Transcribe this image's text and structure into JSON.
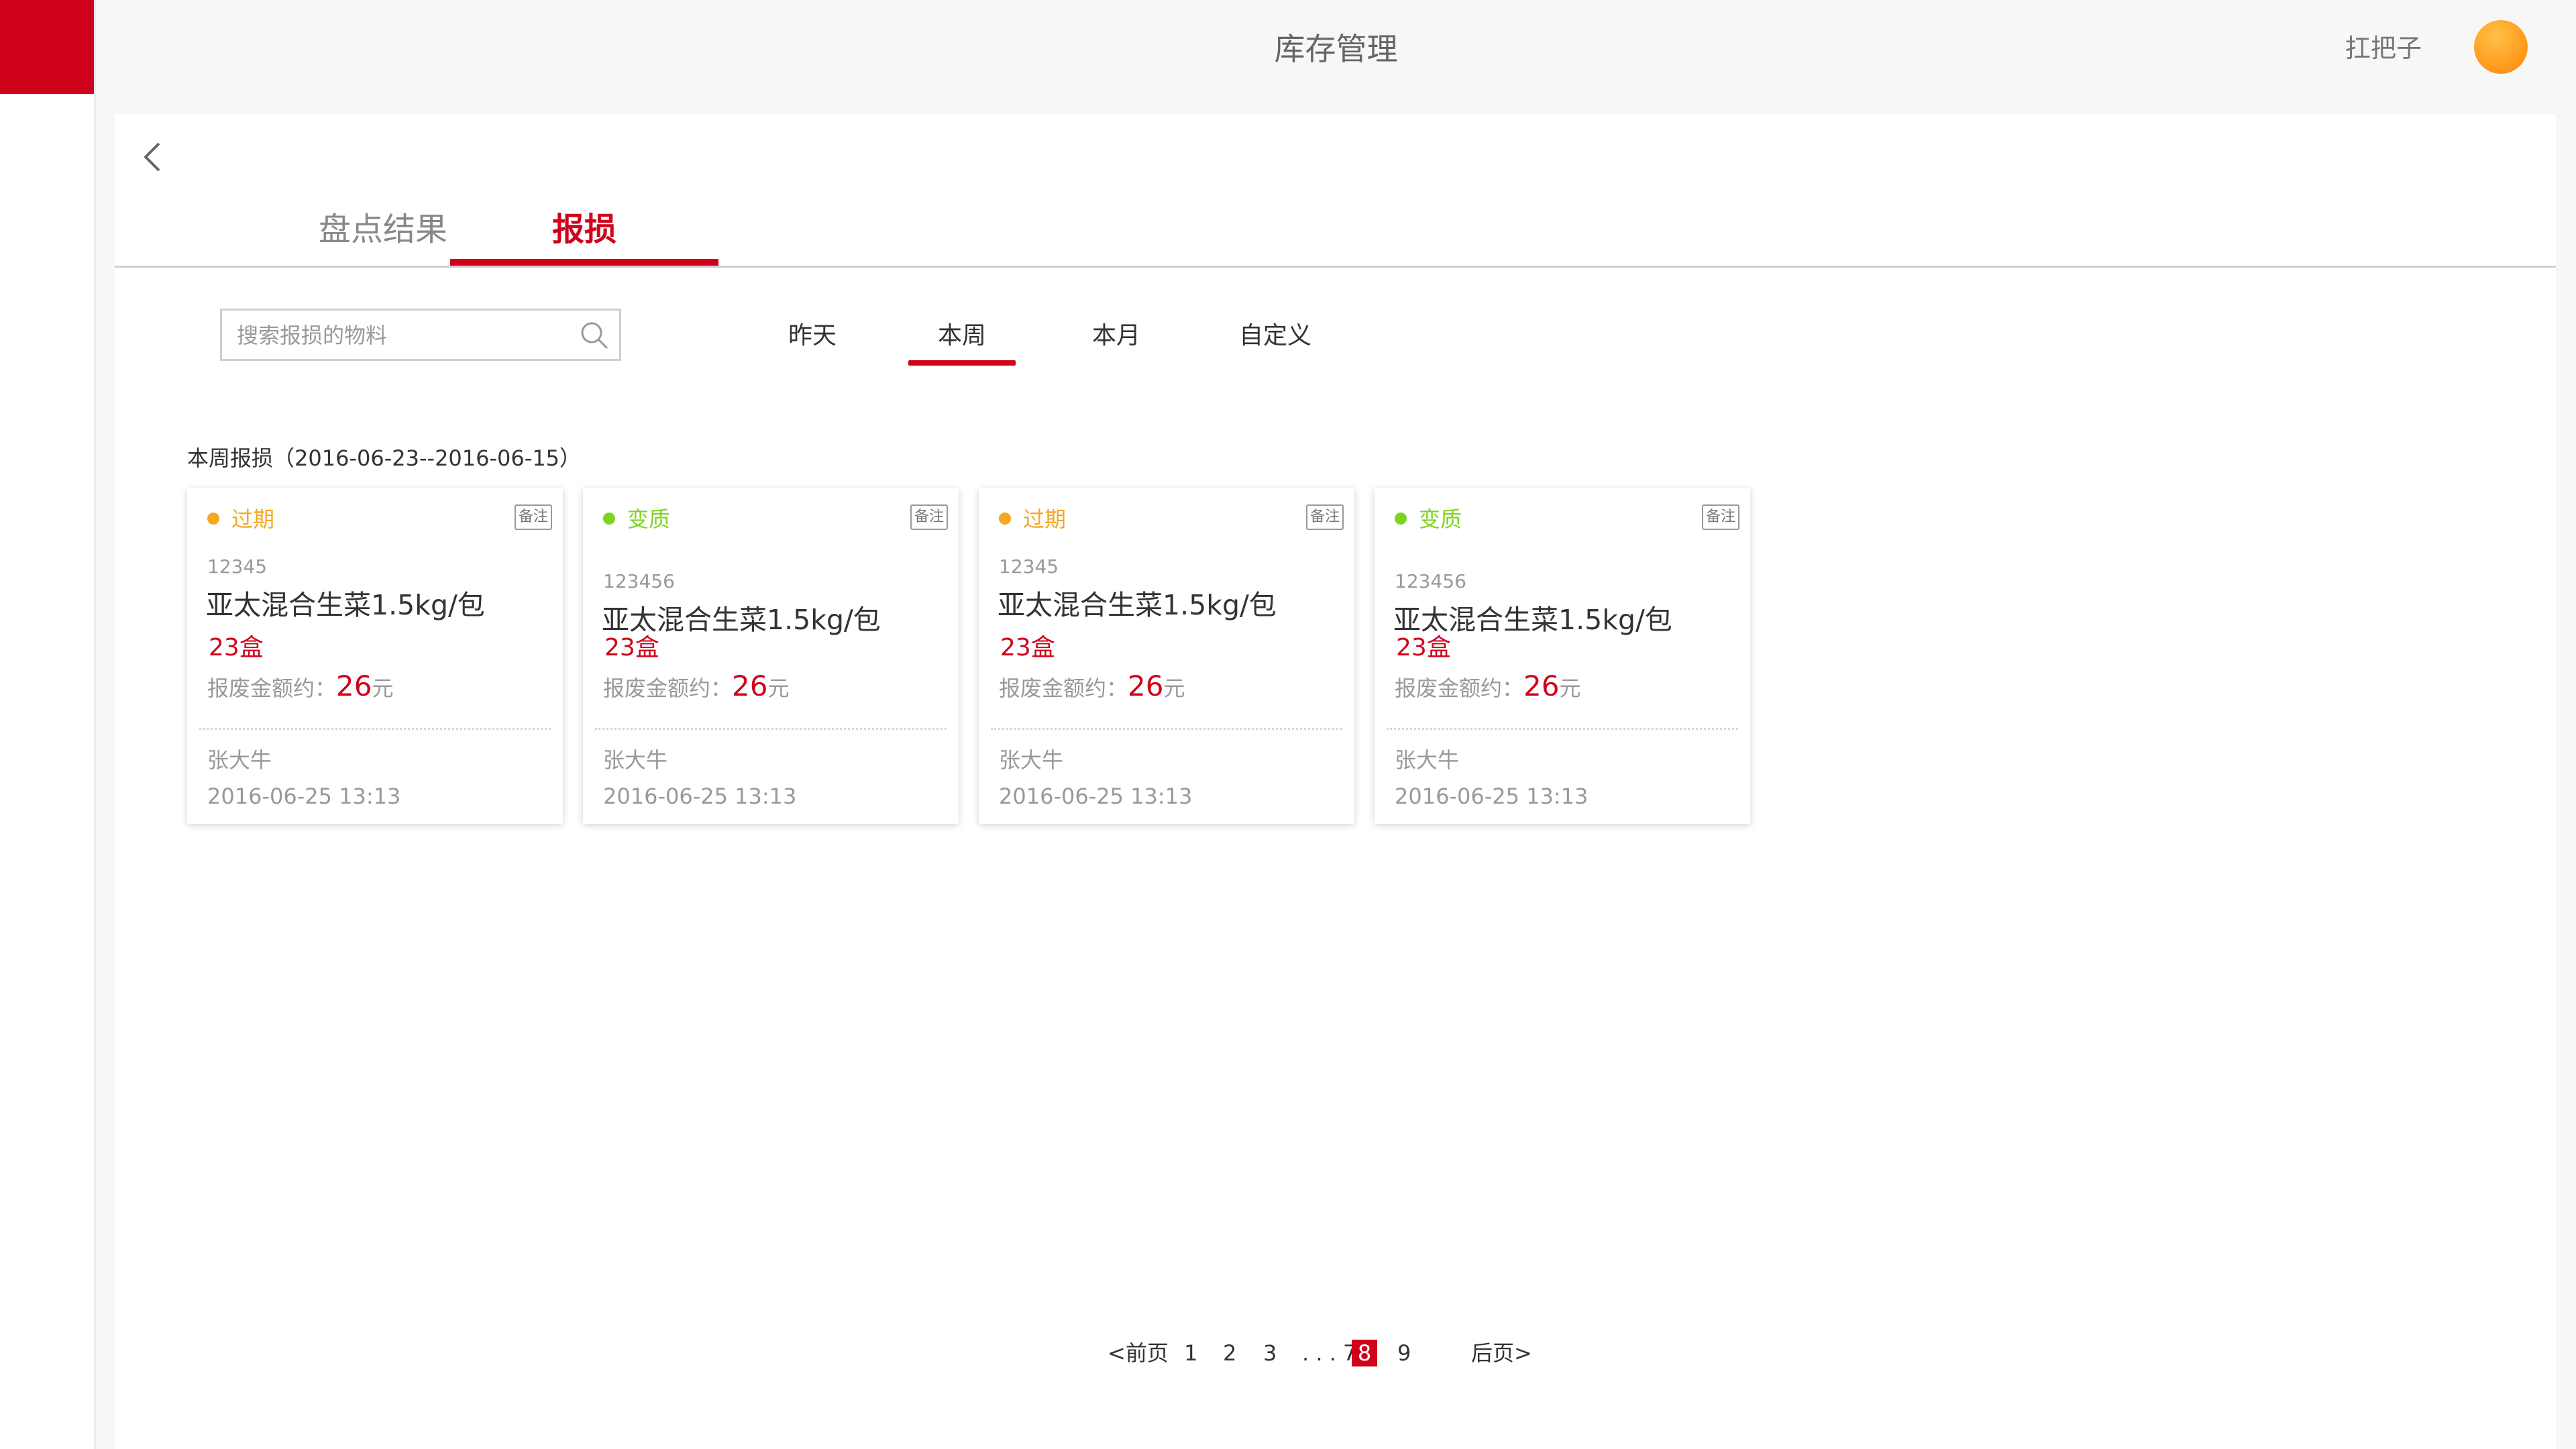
{
  "header": {
    "title": "库存管理",
    "user_name": "扛把子"
  },
  "tabs": [
    {
      "label": "盘点结果",
      "active": false
    },
    {
      "label": "报损",
      "active": true
    }
  ],
  "search": {
    "placeholder": "搜索报损的物料",
    "value": ""
  },
  "filters": [
    {
      "label": "昨天",
      "active": false
    },
    {
      "label": "本周",
      "active": true
    },
    {
      "label": "本月",
      "active": false
    },
    {
      "label": "自定义",
      "active": false
    }
  ],
  "period_label": "本周报损（2016-06-23--2016-06-15）",
  "cards": [
    {
      "status": "过期",
      "status_color": "#f5a623",
      "note_label": "备注",
      "code": "12345",
      "product": "亚太混合生菜1.5kg/包",
      "qty": "23盒",
      "amount_prefix": "报废金额约：",
      "amount": "26",
      "amount_unit": "元",
      "person": "张大牛",
      "date": "2016-06-25 13:13"
    },
    {
      "status": "变质",
      "status_color": "#7ed321",
      "note_label": "备注",
      "code": "123456",
      "product": "亚太混合生菜1.5kg/包",
      "qty": "23盒",
      "amount_prefix": "报废金额约：",
      "amount": "26",
      "amount_unit": "元",
      "person": "张大牛",
      "date": "2016-06-25 13:13"
    },
    {
      "status": "过期",
      "status_color": "#f5a623",
      "note_label": "备注",
      "code": "12345",
      "product": "亚太混合生菜1.5kg/包",
      "qty": "23盒",
      "amount_prefix": "报废金额约：",
      "amount": "26",
      "amount_unit": "元",
      "person": "张大牛",
      "date": "2016-06-25 13:13"
    },
    {
      "status": "变质",
      "status_color": "#7ed321",
      "note_label": "备注",
      "code": "123456",
      "product": "亚太混合生菜1.5kg/包",
      "qty": "23盒",
      "amount_prefix": "报废金额约：",
      "amount": "26",
      "amount_unit": "元",
      "person": "张大牛",
      "date": "2016-06-25 13:13"
    }
  ],
  "pagination": {
    "prev_label": "<前页",
    "pages": [
      "1",
      "2",
      "3"
    ],
    "ellipsis": ". . . 7",
    "current": "8",
    "after": "9",
    "next_label": "后页>"
  },
  "colors": {
    "accent": "#d0021b",
    "expired": "#f5a623",
    "spoiled": "#7ed321"
  },
  "icons": {
    "back": "chevron-left-icon",
    "search": "search-icon",
    "avatar": "avatar"
  }
}
